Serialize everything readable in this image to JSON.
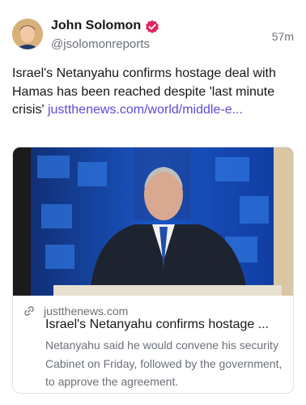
{
  "author": {
    "name": "John Solomon",
    "handle": "@jsolomonreports",
    "timestamp": "57m"
  },
  "post": {
    "text": "Israel's Netanyahu confirms hostage deal with Hamas has been reached despite 'last minute crisis' ",
    "link_text": "justthenews.com/world/middle-e..."
  },
  "card": {
    "domain": "justthenews.com",
    "title": "Israel's Netanyahu confirms hostage ...",
    "description": "Netanyahu said he would convene his security Cabinet on Friday, followed by the government, to approve the agreement."
  },
  "icons": {
    "verified": "verified-badge-icon",
    "link": "link-icon"
  },
  "colors": {
    "verified_badge": "#e0245e",
    "link": "#5b4bd6",
    "secondary_text": "#6b7078",
    "card_border": "#dfe1e5"
  }
}
